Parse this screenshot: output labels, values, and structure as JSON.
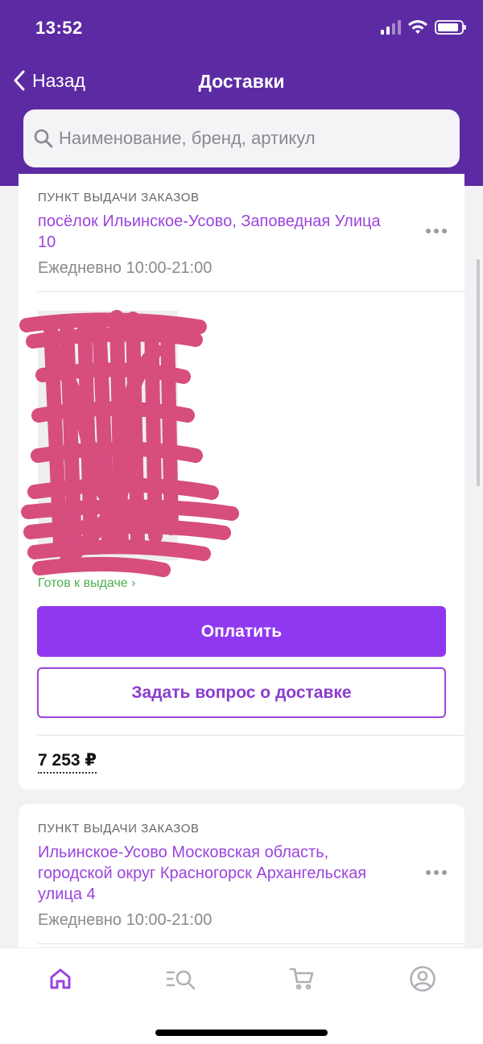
{
  "status_bar": {
    "time": "13:52",
    "icons": [
      "signal-icon",
      "wifi-icon",
      "battery-icon"
    ]
  },
  "nav": {
    "back_label": "Назад",
    "title": "Доставки"
  },
  "search": {
    "placeholder": "Наименование, бренд, артикул"
  },
  "deliveries": [
    {
      "type_label": "ПУНКТ ВЫДАЧИ ЗАКАЗОВ",
      "address": "посёлок Ильинское-Усово, Заповедная Улица 10",
      "hours": "Ежедневно 10:00-21:00",
      "status": "Готов к выдаче ›",
      "pay_button": "Оплатить",
      "ask_button": "Задать вопрос о доставке",
      "total": "7 253 ₽"
    },
    {
      "type_label": "ПУНКТ ВЫДАЧИ ЗАКАЗОВ",
      "address": "Ильинское-Усово Московская область, городской округ Красногорск Архангельская улица 4",
      "hours": "Ежедневно 10:00-21:00"
    }
  ],
  "tabbar": [
    "home-icon",
    "catalog-search-icon",
    "cart-icon",
    "profile-icon"
  ],
  "colors": {
    "header": "#5c2ba3",
    "accent": "#9038ef",
    "link": "#9b44dd",
    "ready": "#4caf50",
    "redaction": "#d64d7e"
  }
}
